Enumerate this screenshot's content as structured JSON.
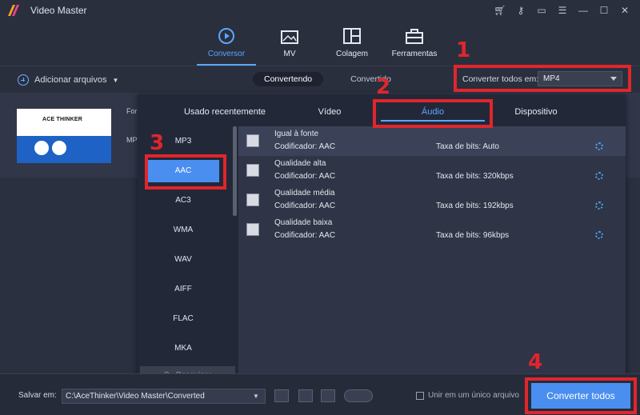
{
  "app": {
    "title": "Video Master"
  },
  "nav": [
    {
      "label": "Conversor",
      "icon": "convert-icon"
    },
    {
      "label": "MV",
      "icon": "mv-icon"
    },
    {
      "label": "Colagem",
      "icon": "collage-icon"
    },
    {
      "label": "Ferramentas",
      "icon": "toolbox-icon"
    }
  ],
  "toolbar": {
    "add_files": "Adicionar arquivos",
    "tabs": [
      "Convertendo",
      "Convertido"
    ],
    "convert_all_label": "Converter todos em:",
    "convert_all_value": "MP4"
  },
  "file": {
    "thumb_brand": "ACE THINKER",
    "side_labels": [
      "For",
      "MP"
    ]
  },
  "format_panel": {
    "tabs": [
      "Usado recentemente",
      "Vídeo",
      "Áudio",
      "Dispositivo"
    ],
    "active_tab": "Áudio",
    "codecs": [
      "MP3",
      "AAC",
      "AC3",
      "WMA",
      "WAV",
      "AIFF",
      "FLAC",
      "MKA"
    ],
    "selected_codec": "AAC",
    "search_placeholder": "Pesquisar",
    "presets": [
      {
        "name": "Igual à fonte",
        "encoder": "Codificador: AAC",
        "bitrate": "Taxa de bits: Auto"
      },
      {
        "name": "Qualidade alta",
        "encoder": "Codificador: AAC",
        "bitrate": "Taxa de bits: 320kbps"
      },
      {
        "name": "Qualidade média",
        "encoder": "Codificador: AAC",
        "bitrate": "Taxa de bits: 192kbps"
      },
      {
        "name": "Qualidade baixa",
        "encoder": "Codificador: AAC",
        "bitrate": "Taxa de bits: 96kbps"
      }
    ]
  },
  "bottom": {
    "save_label": "Salvar em:",
    "save_path": "C:\\AceThinker\\Video Master\\Converted",
    "merge_label": "Unir em um único arquivo",
    "convert_button": "Converter todos"
  },
  "annotations": [
    "1",
    "2",
    "3",
    "4"
  ],
  "colors": {
    "accent": "#4a8ef0",
    "annotation": "#e0262c"
  }
}
